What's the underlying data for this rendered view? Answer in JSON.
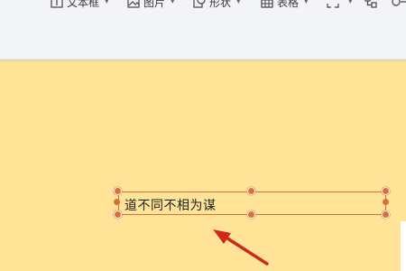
{
  "toolbar": {
    "items": [
      {
        "label": "文本框",
        "icon": "text-box-icon",
        "has_caret": true
      },
      {
        "label": "图片",
        "icon": "image-icon",
        "has_caret": true
      },
      {
        "label": "形状",
        "icon": "shape-icon",
        "has_caret": true
      },
      {
        "label": "表格",
        "icon": "table-icon",
        "has_caret": true
      },
      {
        "label": "",
        "icon": "fullscreen-icon",
        "has_caret": true
      },
      {
        "label": "",
        "icon": "flowchart-icon",
        "has_caret": false
      },
      {
        "label": "",
        "icon": "more-icon",
        "has_caret": false
      }
    ],
    "caret": "▾"
  },
  "canvas": {
    "background": "#ffe497",
    "textbox": {
      "text": "道不同不相为谋",
      "border_color": "#d9703a"
    },
    "annotation_arrow": {
      "color": "#d0281c",
      "points_to": "textbox"
    }
  }
}
